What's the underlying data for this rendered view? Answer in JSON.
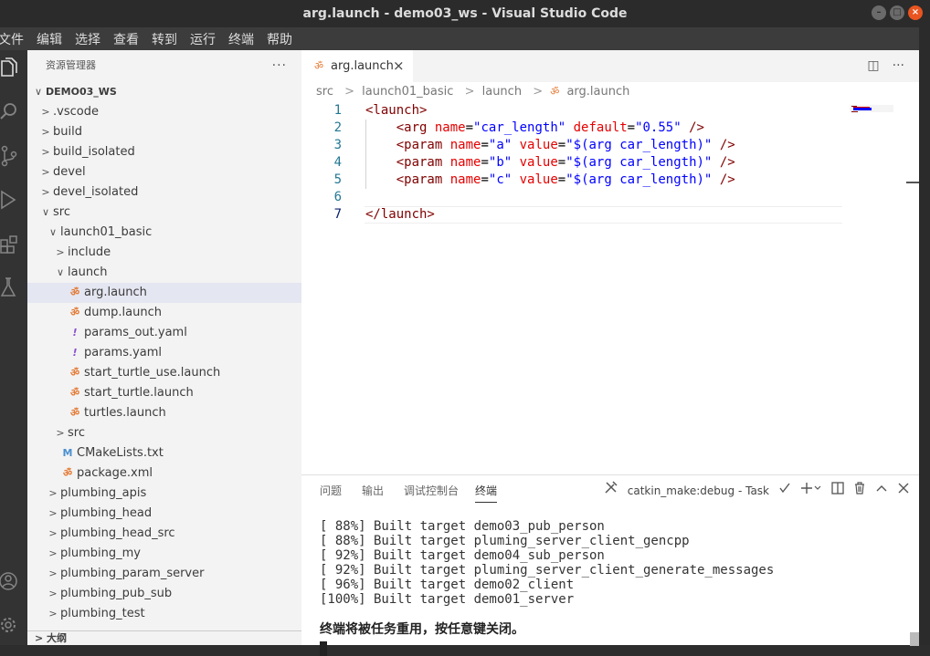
{
  "window": {
    "title": "arg.launch - demo03_ws - Visual Studio Code",
    "btn_min": "–",
    "btn_max": "□",
    "btn_close": "×"
  },
  "menu": [
    "文件",
    "编辑",
    "选择",
    "查看",
    "转到",
    "运行",
    "终端",
    "帮助"
  ],
  "activity": [
    "explorer-icon",
    "search-icon",
    "source-control-icon",
    "run-debug-icon",
    "extensions-icon",
    "testing-icon",
    "account-icon",
    "settings-gear-icon"
  ],
  "sidebar": {
    "title": "资源管理器",
    "more": "···",
    "items": [
      {
        "label": "DEMO03_WS",
        "twisty": "∨"
      },
      {
        "label": ".vscode",
        "twisty": ">"
      },
      {
        "label": "build",
        "twisty": ">"
      },
      {
        "label": "build_isolated",
        "twisty": ">"
      },
      {
        "label": "devel",
        "twisty": ">"
      },
      {
        "label": "devel_isolated",
        "twisty": ">"
      },
      {
        "label": "src",
        "twisty": "∨"
      },
      {
        "label": "launch01_basic",
        "twisty": "∨"
      },
      {
        "label": "include",
        "twisty": ">"
      },
      {
        "label": "launch",
        "twisty": "∨"
      },
      {
        "label": "arg.launch",
        "file_icon": "ॐ"
      },
      {
        "label": "dump.launch",
        "file_icon": "ॐ"
      },
      {
        "label": "params_out.yaml",
        "file_icon": "!"
      },
      {
        "label": "params.yaml",
        "file_icon": "!"
      },
      {
        "label": "start_turtle_use.launch",
        "file_icon": "ॐ"
      },
      {
        "label": "start_turtle.launch",
        "file_icon": "ॐ"
      },
      {
        "label": "turtles.launch",
        "file_icon": "ॐ"
      },
      {
        "label": "src",
        "twisty": ">"
      },
      {
        "label": "CMakeLists.txt",
        "file_icon": "M"
      },
      {
        "label": "package.xml",
        "file_icon": "ॐ"
      },
      {
        "label": "plumbing_apis",
        "twisty": ">"
      },
      {
        "label": "plumbing_head",
        "twisty": ">"
      },
      {
        "label": "plumbing_head_src",
        "twisty": ">"
      },
      {
        "label": "plumbing_my",
        "twisty": ">"
      },
      {
        "label": "plumbing_param_server",
        "twisty": ">"
      },
      {
        "label": "plumbing_pub_sub",
        "twisty": ">"
      },
      {
        "label": "plumbing_test",
        "twisty": ">"
      }
    ],
    "outline": "> 大纲"
  },
  "editor": {
    "tab_label": "arg.launch",
    "tab_close": "×",
    "tab_icon": "ॐ",
    "split": "◫",
    "more": "···",
    "breadcrumbs": [
      "src",
      "launch01_basic",
      "launch",
      "arg.launch"
    ],
    "breadcrumb_sep": ">",
    "line_numbers": [
      "1",
      "2",
      "3",
      "4",
      "5",
      "6",
      "7"
    ],
    "code": {
      "l1_open": "<launch>",
      "l2_tag": "<arg",
      "l2_a1": "name",
      "l2_v1": "\"car_length\"",
      "l2_a2": "default",
      "l2_v2": "\"0.55\"",
      "l2_end": "/>",
      "l3_tag": "<param",
      "l3_a1": "name",
      "l3_v1": "\"a\"",
      "l3_a2": "value",
      "l3_v2": "\"$(arg car_length)\"",
      "l3_end": "/>",
      "l4_tag": "<param",
      "l4_a1": "name",
      "l4_v1": "\"b\"",
      "l4_a2": "value",
      "l4_v2": "\"$(arg car_length)\"",
      "l4_end": "/>",
      "l5_tag": "<param",
      "l5_a1": "name",
      "l5_v1": "\"c\"",
      "l5_a2": "value",
      "l5_v2": "\"$(arg car_length)\"",
      "l5_end": "/>",
      "l7_close": "</launch>"
    }
  },
  "panel": {
    "tabs": [
      "问题",
      "输出",
      "调试控制台",
      "终端"
    ],
    "task": "catkin_make:debug - Task",
    "terminal_lines": [
      "[ 88%] Built target demo03_pub_person",
      "[ 88%] Built target pluming_server_client_gencpp",
      "[ 92%] Built target demo04_sub_person",
      "[ 92%] Built target pluming_server_client_generate_messages",
      "[ 96%] Built target demo02_client",
      "[100%] Built target demo01_server"
    ],
    "message": "终端将被任务重用，按任意键关闭。"
  }
}
